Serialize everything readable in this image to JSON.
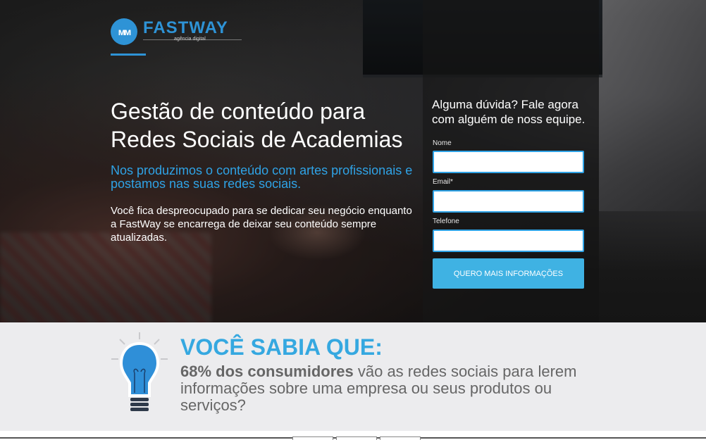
{
  "brand": {
    "badge": "ᴍᴍ",
    "name": "FASTWAY",
    "tagline": "agência digital",
    "color": "#2e93d6"
  },
  "hero": {
    "title": "Gestão de conteúdo para Redes Sociais de Academias",
    "subtitle": "Nos produzimos o conteúdo com artes profissionais e postamos nas suas redes sociais.",
    "body": "Você fica despreocupado para se dedicar seu negócio enquanto a FastWay se encarrega de deixar seu conteúdo sempre atualizadas."
  },
  "form": {
    "title": "Alguma dúvida? Fale agora com alguém de noss equipe.",
    "fields": [
      {
        "label": "Nome",
        "value": ""
      },
      {
        "label": "Email*",
        "value": ""
      },
      {
        "label": "Telefone",
        "value": ""
      }
    ],
    "submit_label": "QUERO MAIS INFORMAÇÕES",
    "accent": "#3fb2e3"
  },
  "info": {
    "heading": "VOCÊ SABIA QUE:",
    "highlight": "68% dos consumidores",
    "text": " vão as redes sociais para lerem informações sobre uma empresa ou seus produtos ou serviços?",
    "icon": "lightbulb-icon",
    "accent": "#35a8e0"
  }
}
